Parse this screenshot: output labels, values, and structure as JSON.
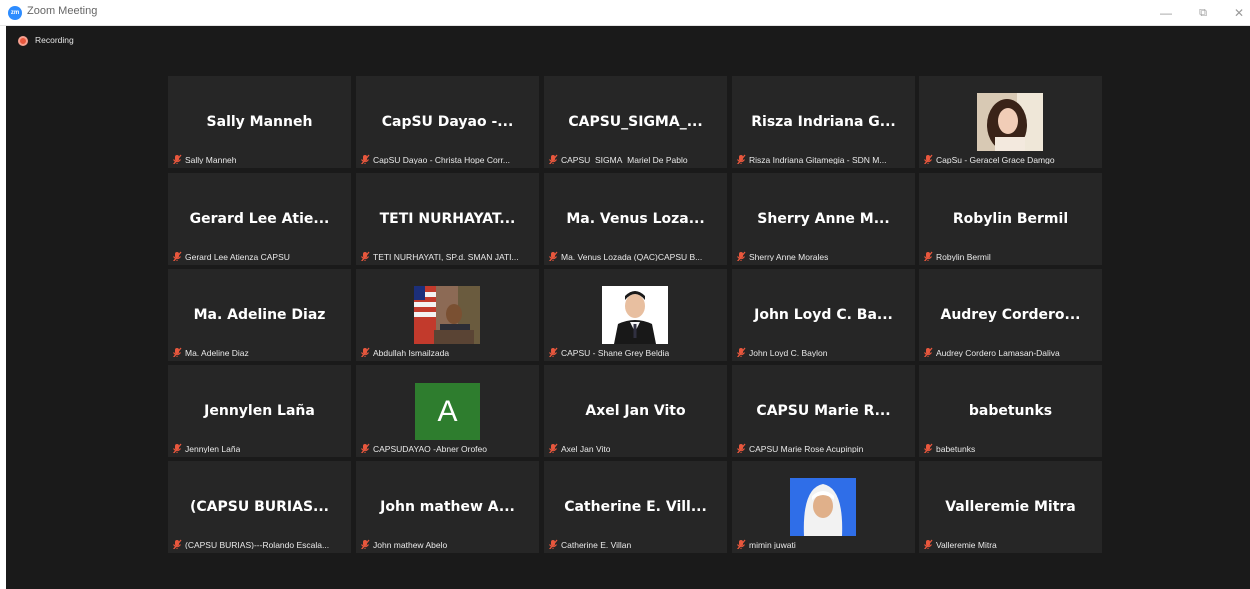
{
  "window": {
    "title": "Zoom Meeting",
    "logo_text": "zm",
    "minimize": "—",
    "restore": "⧉",
    "close": "✕"
  },
  "recording": {
    "label": "Recording"
  },
  "colors": {
    "background": "#1a1a1a",
    "tile": "#262626",
    "muted_mic": "#e8573d",
    "recording": "#e8573d",
    "avatar_green": "#2e7d2e"
  },
  "participants": [
    {
      "display": "Sally Manneh",
      "label": "Sally Manneh"
    },
    {
      "display": "CapSU Dayao  -...",
      "label": "CapSU Dayao  - Christa Hope Corr..."
    },
    {
      "display": "CAPSU_SIGMA_...",
      "label": "CAPSU_SIGMA_Mariel De Pablo"
    },
    {
      "display": "Risza Indriana G...",
      "label": "Risza Indriana Gitamegia - SDN M..."
    },
    {
      "display": "",
      "label": "CapSu - Geracel Grace Damgo",
      "video": "photo-woman-portrait"
    },
    {
      "display": "Gerard Lee Atie...",
      "label": "Gerard Lee Atienza CAPSU"
    },
    {
      "display": "TETI NURHAYAT...",
      "label": "TETI NURHAYATI, SP.d. SMAN JATI..."
    },
    {
      "display": "Ma. Venus Loza...",
      "label": "Ma. Venus Lozada (QAC)CAPSU B..."
    },
    {
      "display": "Sherry Anne M...",
      "label": "Sherry Anne Morales"
    },
    {
      "display": "Robylin Bermil",
      "label": "Robylin Bermil"
    },
    {
      "display": "Ma. Adeline Diaz",
      "label": "Ma. Adeline Diaz"
    },
    {
      "display": "",
      "label": "Abdullah Ismailzada",
      "video": "photo-man-with-flag"
    },
    {
      "display": "",
      "label": "CAPSU - Shane Grey Beldia",
      "video": "photo-man-formal-portrait"
    },
    {
      "display": "John Loyd C. Ba...",
      "label": "John Loyd C. Baylon"
    },
    {
      "display": "Audrey Cordero...",
      "label": "Audrey Cordero Lamasan-Daliva"
    },
    {
      "display": "Jennylen Laña",
      "label": "Jennylen Laña"
    },
    {
      "display": "",
      "label": "CAPSUDAYAO -Abner Orofeo",
      "avatar_letter": "A"
    },
    {
      "display": "Axel Jan Vito",
      "label": "Axel Jan Vito"
    },
    {
      "display": "CAPSU Marie R...",
      "label": "CAPSU Marie Rose Acupinpin"
    },
    {
      "display": "babetunks",
      "label": "babetunks"
    },
    {
      "display": "(CAPSU  BURIAS...",
      "label": "(CAPSU BURIAS)---Rolando Escala..."
    },
    {
      "display": "John mathew A...",
      "label": "John mathew Abelo"
    },
    {
      "display": "Catherine E. Vill...",
      "label": "Catherine E. Villan"
    },
    {
      "display": "",
      "label": "mimin juwati",
      "video": "photo-woman-hijab"
    },
    {
      "display": "Valleremie Mitra",
      "label": "Valleremie Mitra"
    }
  ]
}
